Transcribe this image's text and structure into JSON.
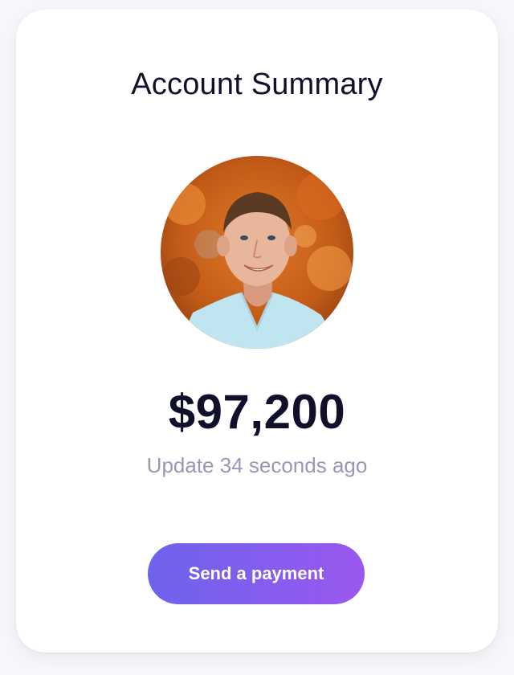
{
  "card": {
    "title": "Account Summary",
    "balance": "$97,200",
    "updated": "Update 34 seconds ago",
    "send_button_label": "Send a payment"
  },
  "colors": {
    "text_primary": "#11102b",
    "text_muted": "#9a96b8",
    "button_gradient_start": "#6d63ec",
    "button_gradient_end": "#9a58ee"
  },
  "icons": {
    "avatar": "profile-photo"
  }
}
